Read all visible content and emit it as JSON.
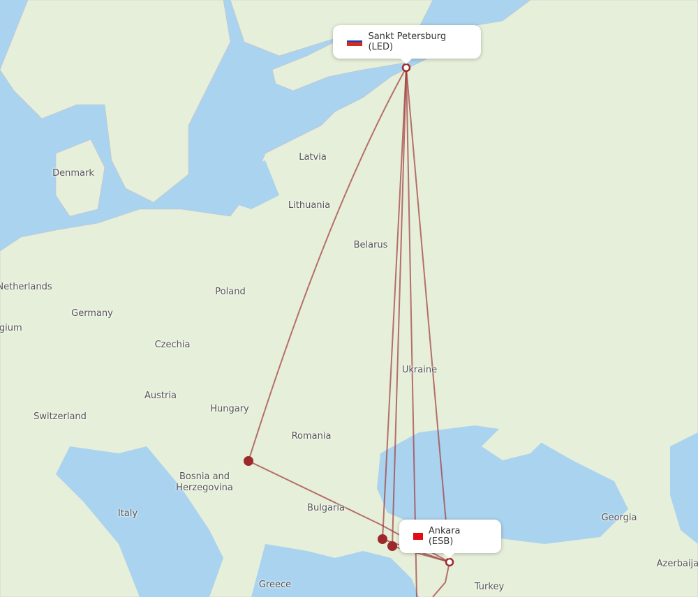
{
  "map": {
    "colors": {
      "land": "#e6efd9",
      "water": "#aad3ef",
      "route": "#a0393a",
      "marker": "#9c2a2c"
    },
    "origin": {
      "label": "Sankt Petersburg (LED)",
      "flag": "russia-flag"
    },
    "destination": {
      "label": "Ankara (ESB)",
      "flag": "turkey-flag"
    },
    "countries": [
      "Denmark",
      "Latvia",
      "Lithuania",
      "Belarus",
      "Netherlands",
      "Belgium",
      "Germany",
      "Poland",
      "Czechia",
      "Ukraine",
      "Austria",
      "Hungary",
      "Switzerland",
      "Romania",
      "Bosnia and Herzegovina",
      "Italy",
      "Bulgaria",
      "Georgia",
      "Azerbaijan",
      "Greece",
      "Turkey"
    ]
  }
}
